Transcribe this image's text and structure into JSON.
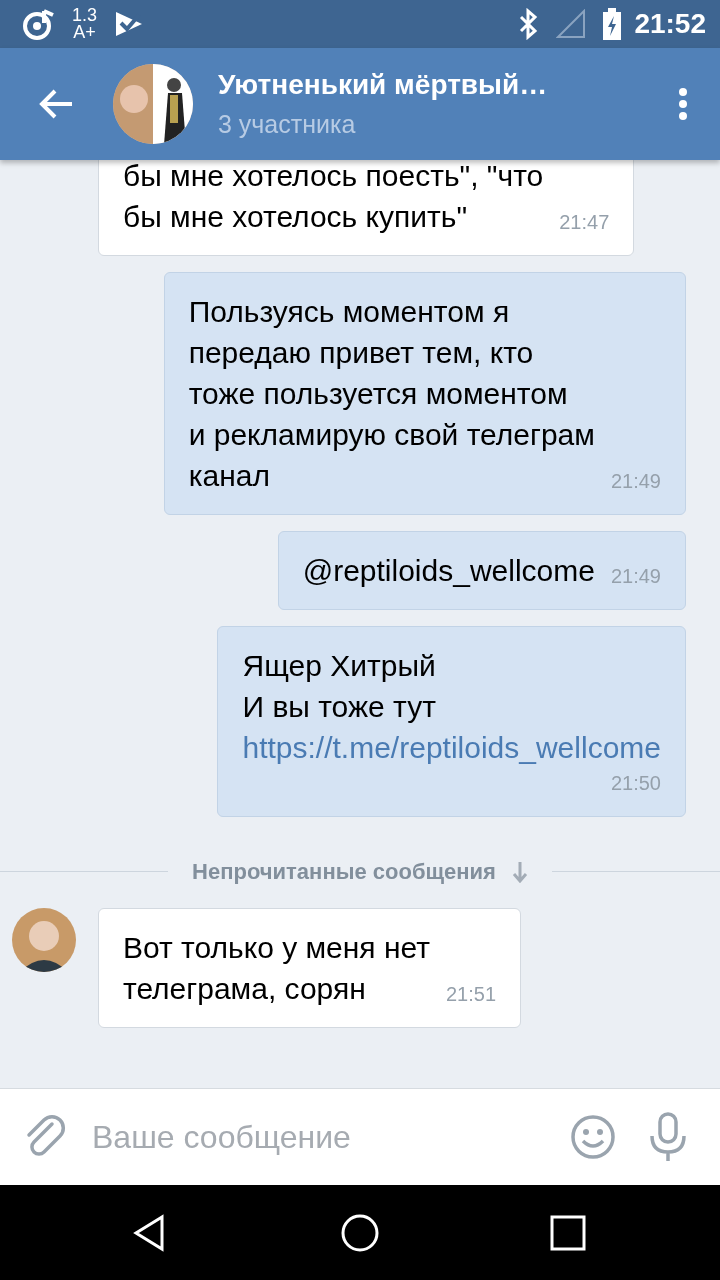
{
  "status_bar": {
    "font_scale": "1.3",
    "font_scale_sub": "A+",
    "time": "21:52"
  },
  "header": {
    "title": "Уютненький мёртвый…",
    "subtitle": "3 участника"
  },
  "messages": [
    {
      "kind": "in",
      "continued": true,
      "text": "бы мне хотелось поесть\", \"что\nбы мне хотелось купить\"",
      "time": "21:47"
    },
    {
      "kind": "out",
      "text": "Пользуясь моментом я\nпередаю привет тем, кто\nтоже пользуется моментом\nи рекламирую свой телеграм\nканал",
      "time": "21:49"
    },
    {
      "kind": "out",
      "text": "@reptiloids_wellcome",
      "time": "21:49"
    },
    {
      "kind": "out",
      "text": "Ящер Хитрый\nИ вы тоже тут",
      "link": "https://t.me/reptiloids_wellcome",
      "time": "21:50"
    },
    {
      "kind": "divider",
      "text": "Непрочитанные сообщения"
    },
    {
      "kind": "in",
      "avatar": true,
      "text": "Вот только у меня нет\nтелеграма, сорян",
      "time": "21:51"
    }
  ],
  "composer": {
    "placeholder": "Ваше сообщение"
  }
}
